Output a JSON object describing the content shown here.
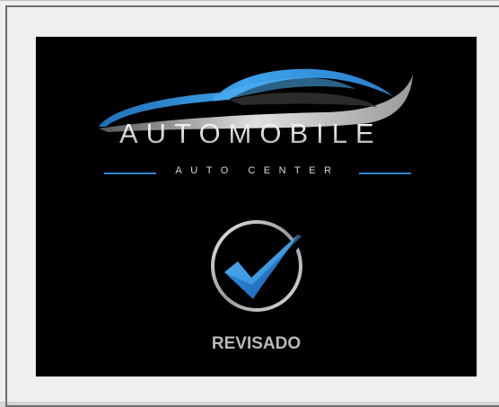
{
  "logo": {
    "brand_name": "AUTOMOBILE",
    "subtitle": "AUTO CENTER"
  },
  "badge": {
    "label": "REVISADO",
    "icon": "checkmark-circle-icon"
  },
  "colors": {
    "background": "#000000",
    "accent_blue": "#2d86cf",
    "silver": "#c8c8c8",
    "frame": "#efefef"
  }
}
